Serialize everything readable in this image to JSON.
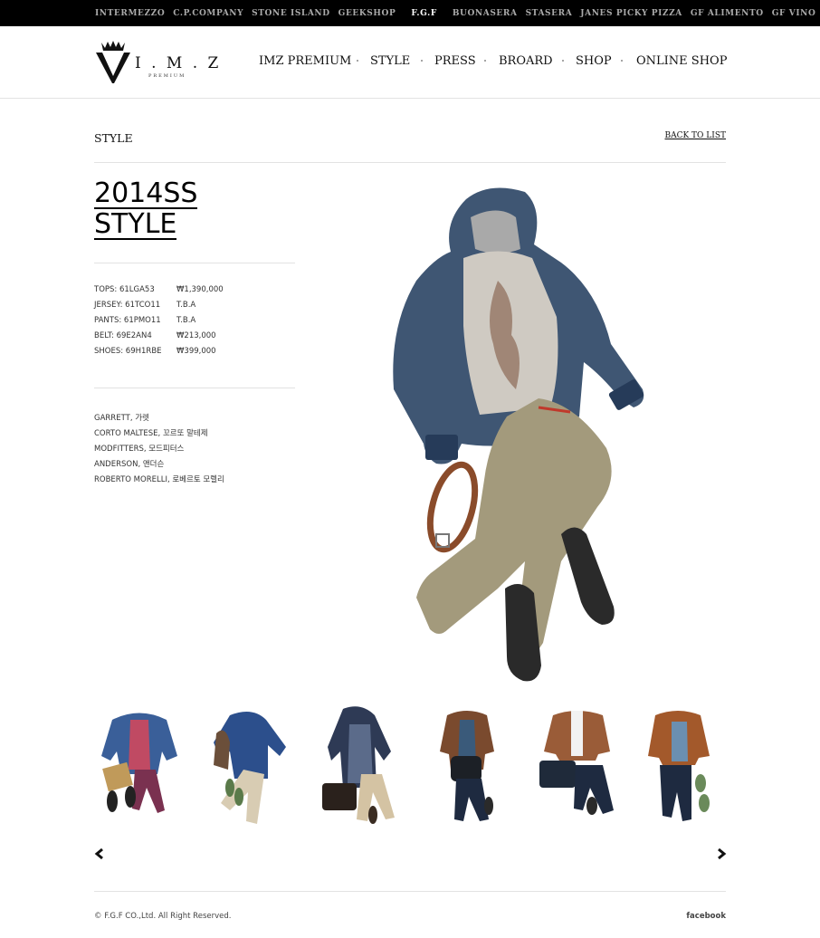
{
  "top_brands": [
    {
      "label": "INTERMEZZO"
    },
    {
      "label": "C.P.COMPANY"
    },
    {
      "label": "STONE ISLAND"
    },
    {
      "label": "GEEKSHOP"
    },
    {
      "label": "F.G.F",
      "active": true
    },
    {
      "label": "BUONASERA"
    },
    {
      "label": "STASERA"
    },
    {
      "label": "JANES PICKY PIZZA"
    },
    {
      "label": "GF ALIMENTO"
    },
    {
      "label": "GF VINO"
    }
  ],
  "logo": {
    "text": "I . M . Z",
    "sub": "PREMIUM"
  },
  "nav": [
    {
      "label": "IMZ PREMIUM"
    },
    {
      "label": "STYLE"
    },
    {
      "label": "PRESS"
    },
    {
      "label": "BROARD"
    },
    {
      "label": "SHOP"
    },
    {
      "label": "ONLINE SHOP"
    }
  ],
  "page": {
    "title": "STYLE",
    "back_link": "BACK TO LIST"
  },
  "style_title": {
    "line1": "2014SS",
    "line2": "STYLE"
  },
  "items": [
    {
      "item": "TOPS: 61LGA53",
      "price": "₩1,390,000"
    },
    {
      "item": "JERSEY: 61TCO11",
      "price": "T.B.A"
    },
    {
      "item": "PANTS: 61PMO11",
      "price": "T.B.A"
    },
    {
      "item": "BELT: 69E2AN4",
      "price": "₩213,000"
    },
    {
      "item": "SHOES: 69H1RBE",
      "price": "₩399,000"
    }
  ],
  "brands": [
    "GARRETT, 가렛",
    "CORTO MALTESE, 꼬르또 말테제",
    "MODFITTERS, 모드피터스",
    "ANDERSON, 앤더슨",
    "ROBERTO MORELLI, 로베르토 모렐리"
  ],
  "footer": {
    "copyright": "© F.G.F CO.,Ltd. All Right Reserved.",
    "facebook": "facebook"
  }
}
